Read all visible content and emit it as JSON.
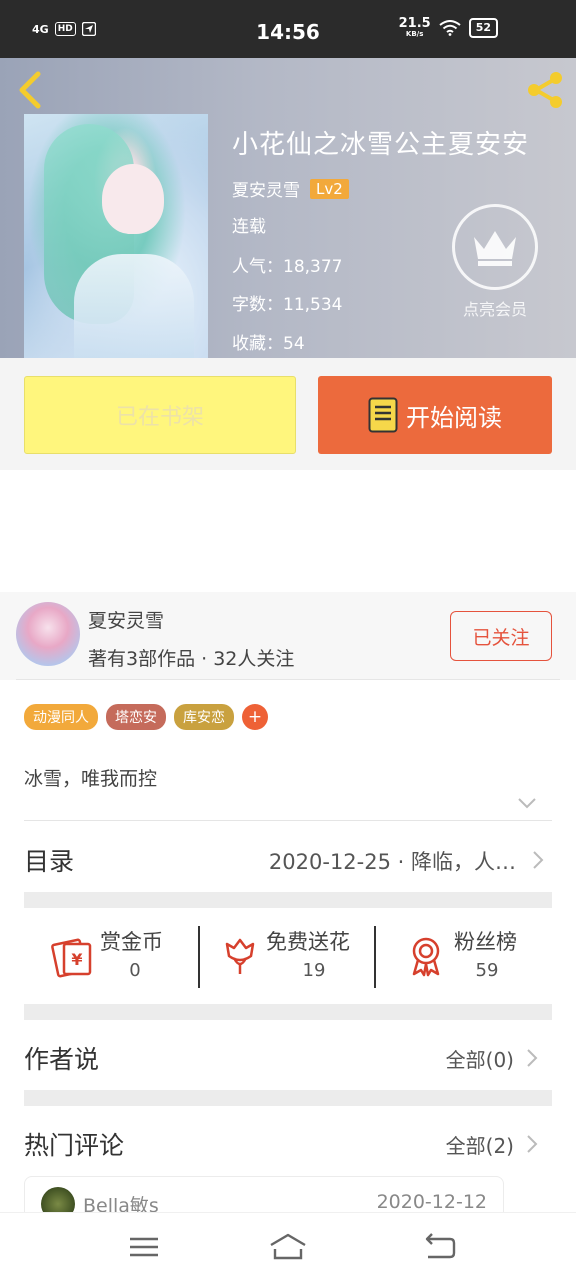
{
  "status_bar": {
    "network": "4G",
    "hd": "HD",
    "time": "14:56",
    "speed": "21.5",
    "speed_unit": "KB/s",
    "battery": "52"
  },
  "header": {
    "book_title": "小花仙之冰雪公主夏安安",
    "author": "夏安灵雪",
    "level": "Lv2",
    "status": "连载",
    "popularity": "人气：18,377",
    "word_count": "字数：11,534",
    "favorites": "收藏：54",
    "vip_label": "点亮会员"
  },
  "actions": {
    "shelf_label": "已在书架",
    "read_label": "开始阅读"
  },
  "author_card": {
    "name": "夏安灵雪",
    "stats": "著有3部作品 · 32人关注",
    "follow_label": "已关注"
  },
  "tags": [
    {
      "label": "动漫同人",
      "color": "#f2a93b"
    },
    {
      "label": "塔恋安",
      "color": "#c56b5b"
    },
    {
      "label": "库安恋",
      "color": "#c9a13f"
    }
  ],
  "tag_add": "+",
  "description": "冰雪，唯我而控",
  "toc": {
    "label": "目录",
    "latest": "2020-12-25 · 降临，人…"
  },
  "stats": [
    {
      "name": "赏金币",
      "value": "0"
    },
    {
      "name": "免费送花",
      "value": "19"
    },
    {
      "name": "粉丝榜",
      "value": "59"
    }
  ],
  "author_says": {
    "title": "作者说",
    "more": "全部(0)"
  },
  "hot_comments": {
    "title": "热门评论",
    "more": "全部(2)",
    "first": {
      "user": "Bella敏s",
      "date": "2020-12-12"
    }
  },
  "colors": {
    "accent_orange": "#ec6a3d",
    "shelf_yellow": "#fff67d",
    "follow_red": "#e5533d",
    "icon_red": "#d6402d"
  }
}
